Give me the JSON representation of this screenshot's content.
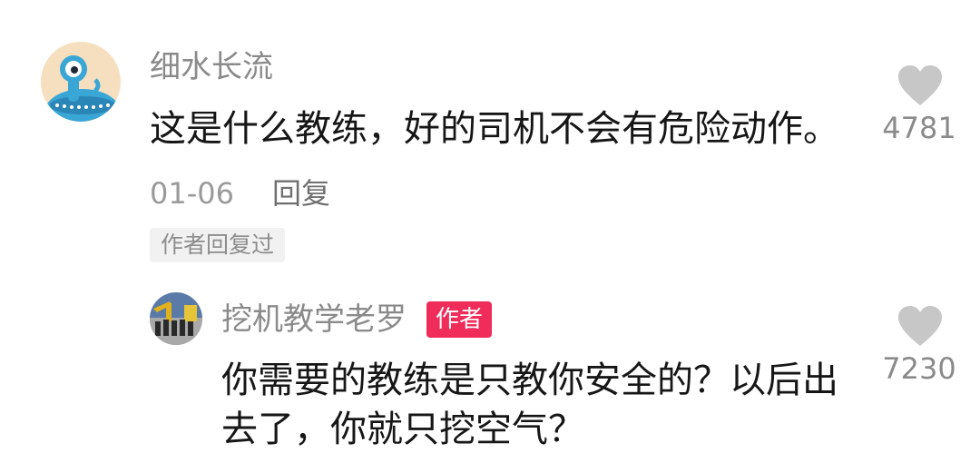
{
  "comment": {
    "username": "细水长流",
    "text": "这是什么教练，好的司机不会有危险动作。",
    "date": "01-06",
    "reply_label": "回复",
    "author_replied_tag": "作者回复过",
    "likes": "4781",
    "avatar_icon": "blue-alien-avatar-icon",
    "like_icon": "heart-icon"
  },
  "reply": {
    "username": "挖机教学老罗",
    "badge": "作者",
    "badge_color": "#f02c5a",
    "text": "你需要的教练是只教你安全的？以后出去了，你就只挖空气？",
    "likes": "7230",
    "avatar_icon": "excavator-group-photo-avatar",
    "like_icon": "heart-icon"
  }
}
